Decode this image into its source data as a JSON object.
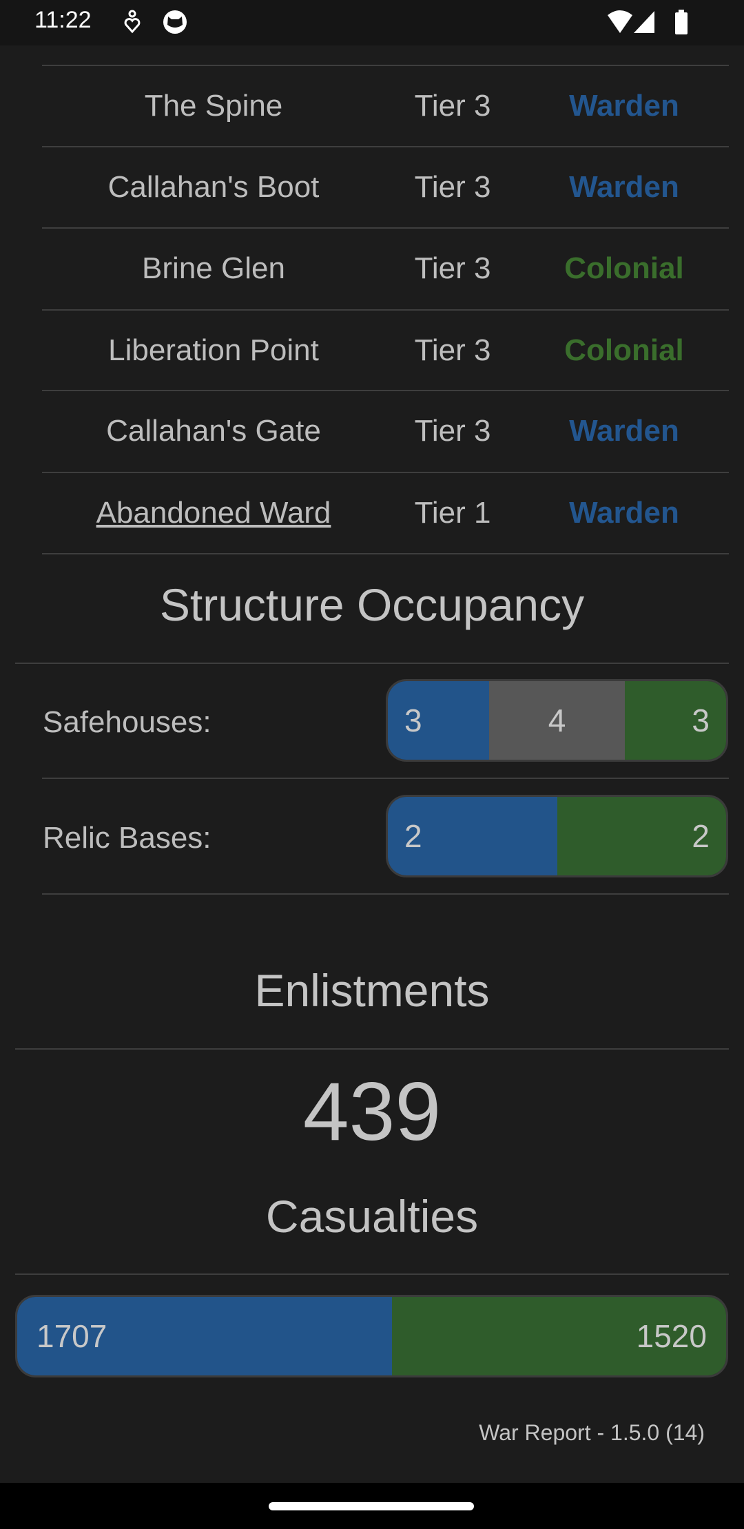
{
  "status_bar": {
    "time": "11:22",
    "icons": [
      "accessibility-icon",
      "cat-face-icon",
      "wifi-icon",
      "signal-icon",
      "battery-icon"
    ]
  },
  "colors": {
    "warden": "#23568f",
    "colonial": "#3a6e2c",
    "warden_bar": "#22548a",
    "colonial_bar": "#2f5c2b",
    "neutral_bar": "#575757"
  },
  "towns": [
    {
      "name": "The Spine",
      "tier": "Tier 3",
      "faction": "Warden",
      "link": false
    },
    {
      "name": "Callahan's Boot",
      "tier": "Tier 3",
      "faction": "Warden",
      "link": false
    },
    {
      "name": "Brine Glen",
      "tier": "Tier 3",
      "faction": "Colonial",
      "link": false
    },
    {
      "name": "Liberation Point",
      "tier": "Tier 3",
      "faction": "Colonial",
      "link": false
    },
    {
      "name": "Callahan's Gate",
      "tier": "Tier 3",
      "faction": "Warden",
      "link": false
    },
    {
      "name": "Abandoned Ward",
      "tier": "Tier 1",
      "faction": "Warden",
      "link": true
    }
  ],
  "structure_occupancy": {
    "title": "Structure Occupancy",
    "safehouses": {
      "label": "Safehouses:",
      "warden": "3",
      "neutral": "4",
      "colonial": "3"
    },
    "relic_bases": {
      "label": "Relic Bases:",
      "warden": "2",
      "colonial": "2"
    }
  },
  "enlistments": {
    "title": "Enlistments",
    "value": "439"
  },
  "casualties": {
    "title": "Casualties",
    "warden": "1707",
    "colonial": "1520"
  },
  "footer": {
    "version": "War Report - 1.5.0 (14)"
  }
}
